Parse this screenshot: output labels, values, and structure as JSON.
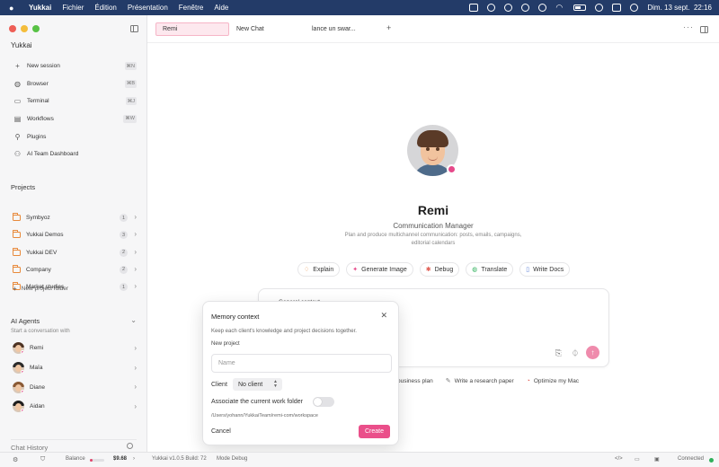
{
  "menubar": {
    "app": "Yukkai",
    "items": [
      "Fichier",
      "Édition",
      "Présentation",
      "Fenêtre",
      "Aide"
    ],
    "date": "Dim. 13 sept.",
    "time": "22:16"
  },
  "sidebar": {
    "brand": "Yukkai",
    "nav": [
      {
        "label": "New session",
        "shortcut": "⌘N",
        "icon": "plus-icon"
      },
      {
        "label": "Browser",
        "shortcut": "⌘B",
        "icon": "globe-icon"
      },
      {
        "label": "Terminal",
        "shortcut": "⌘J",
        "icon": "terminal-icon"
      },
      {
        "label": "Workflows",
        "shortcut": "⌘W",
        "icon": "workflow-icon"
      },
      {
        "label": "Plugins",
        "shortcut": "",
        "icon": "plugin-icon"
      },
      {
        "label": "AI Team Dashboard",
        "shortcut": "",
        "icon": "team-icon"
      }
    ],
    "projects_title": "Projects",
    "projects": [
      {
        "name": "Symbyoz",
        "count": "1"
      },
      {
        "name": "Yukkai Demos",
        "count": "3"
      },
      {
        "name": "Yukkai DEV",
        "count": "2"
      },
      {
        "name": "Company",
        "count": "2"
      },
      {
        "name": "Market studies",
        "count": "1"
      }
    ],
    "new_project_folder": "New project folder",
    "agents_title": "AI Agents",
    "agents_subtitle": "Start a conversation with",
    "agents": [
      {
        "name": "Remi"
      },
      {
        "name": "Maïa"
      },
      {
        "name": "Diane"
      },
      {
        "name": "Aidan"
      }
    ],
    "history_title": "Chat History"
  },
  "statusbar": {
    "balance_label": "Balance",
    "balance_value": "$9.68",
    "version": "Yukkai v1.0.5 Build: 72",
    "mode": "Mode Debug",
    "connection": "Connected"
  },
  "tabs": [
    {
      "label": "Remi",
      "active": true
    },
    {
      "label": "New Chat",
      "active": false
    },
    {
      "label": "lance un swar...",
      "active": false
    }
  ],
  "agent": {
    "name": "Remi",
    "role": "Communication Manager",
    "description_line1": "Plan and produce multichannel communication: posts, emails, campaigns,",
    "description_line2": "editorial calendars"
  },
  "quick_actions": [
    {
      "label": "Explain",
      "icon": "bulb-icon"
    },
    {
      "label": "Generate Image",
      "icon": "sparkle-icon"
    },
    {
      "label": "Debug",
      "icon": "bug-icon"
    },
    {
      "label": "Translate",
      "icon": "globe-icon"
    },
    {
      "label": "Write Docs",
      "icon": "doc-icon"
    }
  ],
  "composer": {
    "context_label": "General context"
  },
  "suggestions": [
    {
      "label": "business plan"
    },
    {
      "label": "Write a research paper"
    },
    {
      "label": "Optimize my Mac"
    }
  ],
  "modal": {
    "title": "Memory context",
    "description": "Keep each client's knowledge and project decisions together.",
    "new_project_label": "New project",
    "name_placeholder": "Name",
    "client_label": "Client",
    "client_value": "No client",
    "associate_label": "Associate the current work folder",
    "associate_enabled": false,
    "path": "/Users/yohann/YukkaiTeam/remi-com/workspace",
    "cancel_label": "Cancel",
    "create_label": "Create"
  },
  "colors": {
    "accent": "#ea4f8a",
    "menubar": "#233b68",
    "folder": "#e8893a",
    "connected": "#2fb05b"
  }
}
